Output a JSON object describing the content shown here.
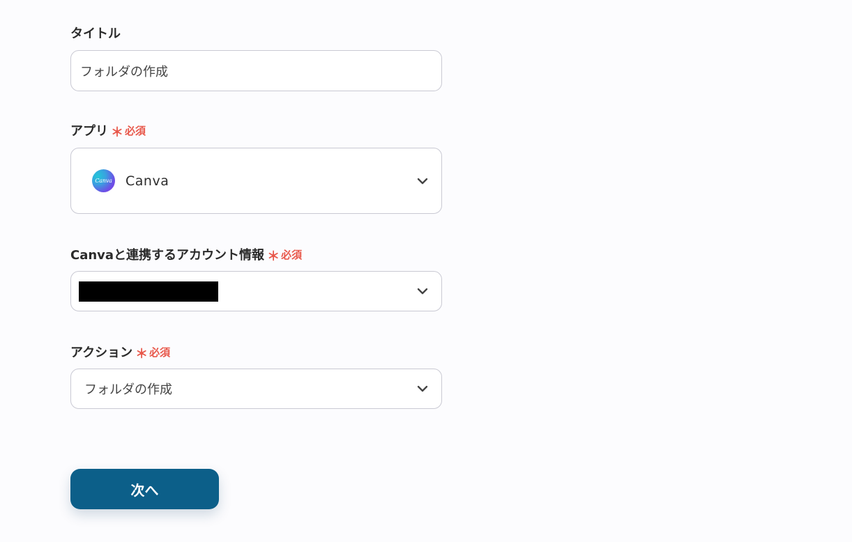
{
  "title_field": {
    "label": "タイトル",
    "value": "フォルダの作成"
  },
  "app_field": {
    "label": "アプリ",
    "required_mark": "＊",
    "required_text": "必須",
    "selected_app": "Canva",
    "logo_text": "Canva",
    "logo_icon": "canva-logo-icon"
  },
  "account_field": {
    "label": "Canvaと連携するアカウント情報",
    "required_mark": "＊",
    "required_text": "必須",
    "value_redacted": true
  },
  "action_field": {
    "label": "アクション",
    "required_mark": "＊",
    "required_text": "必須",
    "value": "フォルダの作成"
  },
  "next_button": {
    "label": "次へ"
  },
  "colors": {
    "primary": "#0c5f89",
    "required": "#e8584b",
    "border": "#c9c9d3",
    "background": "#fcfcfe"
  },
  "icons": {
    "dropdown": "chevron-down-icon"
  }
}
